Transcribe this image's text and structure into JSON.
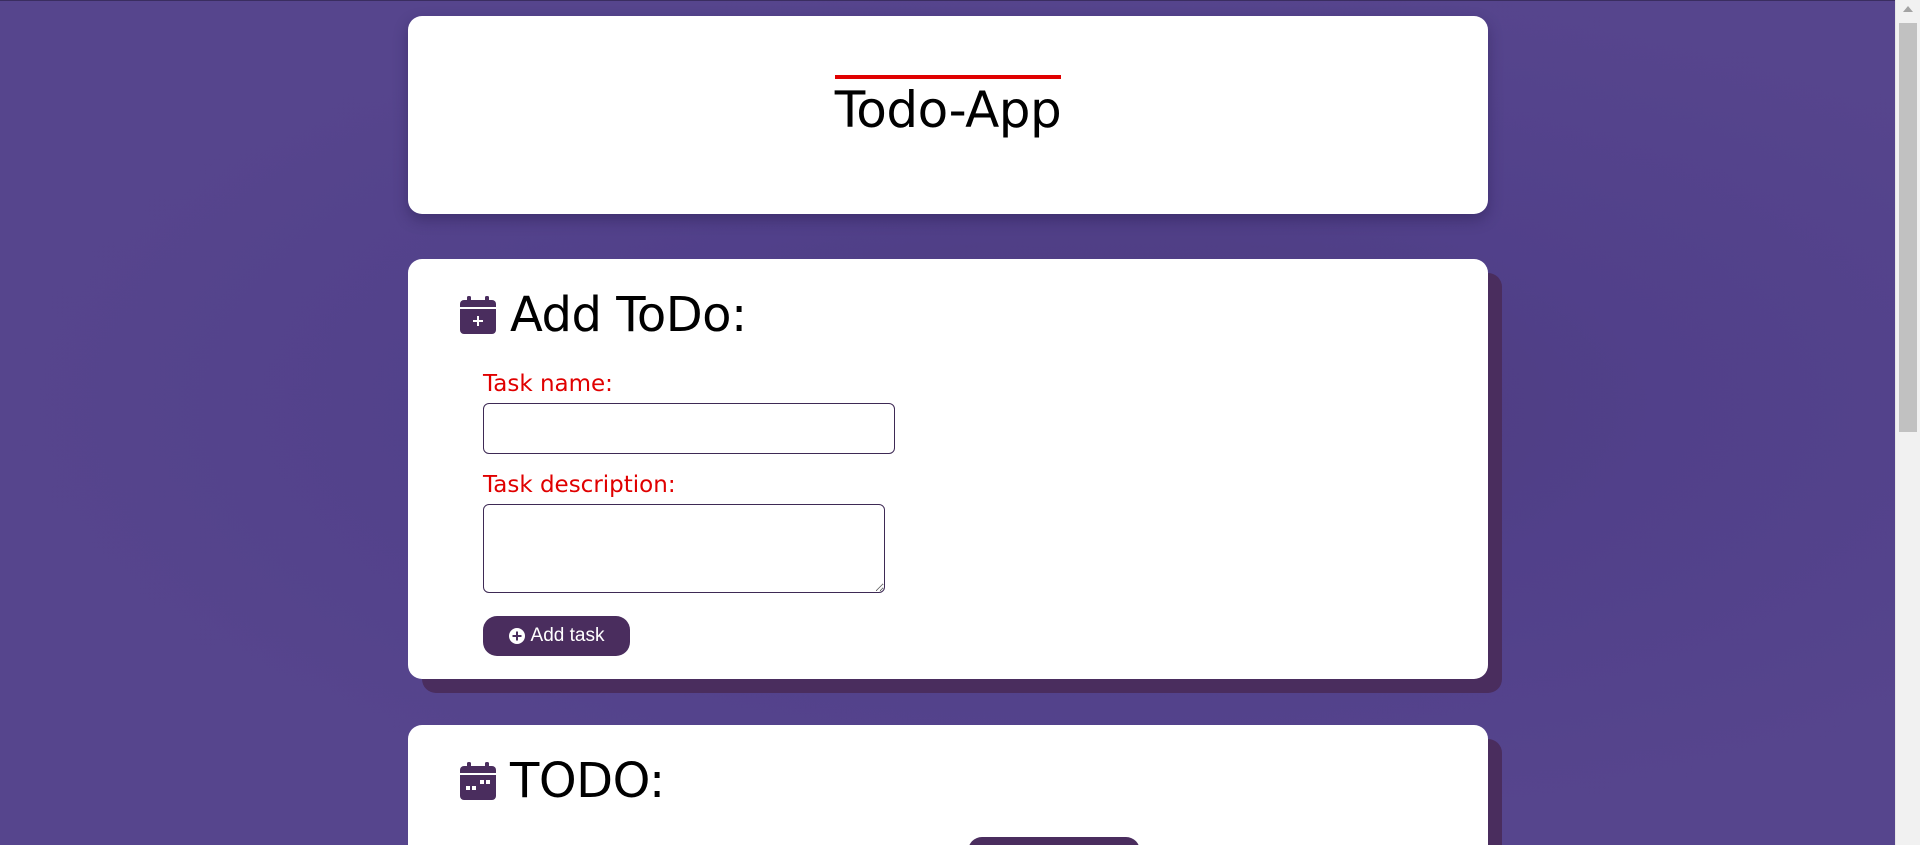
{
  "app": {
    "title": "Todo-App"
  },
  "add_section": {
    "title": "Add ToDo:",
    "icon": "calendar-plus-icon",
    "task_name_label": "Task name:",
    "task_name_value": "",
    "task_description_label": "Task description:",
    "task_description_value": "",
    "add_button_label": "Add task",
    "add_button_icon": "circle-plus-icon"
  },
  "todo_section": {
    "title": "TODO:",
    "icon": "calendar-week-icon"
  },
  "colors": {
    "background": "#56458d",
    "accent": "#4a2d5e",
    "label_red": "#e00000",
    "card": "#ffffff"
  }
}
